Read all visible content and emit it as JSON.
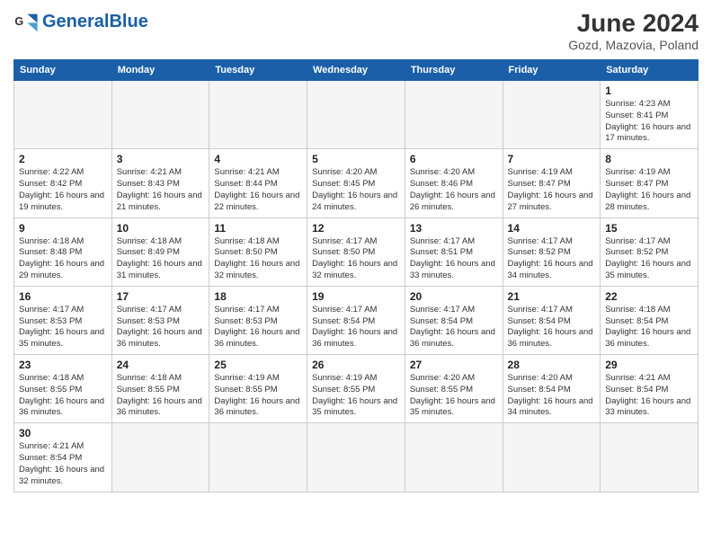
{
  "header": {
    "logo_general": "General",
    "logo_blue": "Blue",
    "month_year": "June 2024",
    "location": "Gozd, Mazovia, Poland"
  },
  "days_of_week": [
    "Sunday",
    "Monday",
    "Tuesday",
    "Wednesday",
    "Thursday",
    "Friday",
    "Saturday"
  ],
  "weeks": [
    [
      {
        "num": "",
        "info": ""
      },
      {
        "num": "",
        "info": ""
      },
      {
        "num": "",
        "info": ""
      },
      {
        "num": "",
        "info": ""
      },
      {
        "num": "",
        "info": ""
      },
      {
        "num": "",
        "info": ""
      },
      {
        "num": "1",
        "info": "Sunrise: 4:23 AM\nSunset: 8:41 PM\nDaylight: 16 hours and 17 minutes."
      }
    ],
    [
      {
        "num": "2",
        "info": "Sunrise: 4:22 AM\nSunset: 8:42 PM\nDaylight: 16 hours and 19 minutes."
      },
      {
        "num": "3",
        "info": "Sunrise: 4:21 AM\nSunset: 8:43 PM\nDaylight: 16 hours and 21 minutes."
      },
      {
        "num": "4",
        "info": "Sunrise: 4:21 AM\nSunset: 8:44 PM\nDaylight: 16 hours and 22 minutes."
      },
      {
        "num": "5",
        "info": "Sunrise: 4:20 AM\nSunset: 8:45 PM\nDaylight: 16 hours and 24 minutes."
      },
      {
        "num": "6",
        "info": "Sunrise: 4:20 AM\nSunset: 8:46 PM\nDaylight: 16 hours and 26 minutes."
      },
      {
        "num": "7",
        "info": "Sunrise: 4:19 AM\nSunset: 8:47 PM\nDaylight: 16 hours and 27 minutes."
      },
      {
        "num": "8",
        "info": "Sunrise: 4:19 AM\nSunset: 8:47 PM\nDaylight: 16 hours and 28 minutes."
      }
    ],
    [
      {
        "num": "9",
        "info": "Sunrise: 4:18 AM\nSunset: 8:48 PM\nDaylight: 16 hours and 29 minutes."
      },
      {
        "num": "10",
        "info": "Sunrise: 4:18 AM\nSunset: 8:49 PM\nDaylight: 16 hours and 31 minutes."
      },
      {
        "num": "11",
        "info": "Sunrise: 4:18 AM\nSunset: 8:50 PM\nDaylight: 16 hours and 32 minutes."
      },
      {
        "num": "12",
        "info": "Sunrise: 4:17 AM\nSunset: 8:50 PM\nDaylight: 16 hours and 32 minutes."
      },
      {
        "num": "13",
        "info": "Sunrise: 4:17 AM\nSunset: 8:51 PM\nDaylight: 16 hours and 33 minutes."
      },
      {
        "num": "14",
        "info": "Sunrise: 4:17 AM\nSunset: 8:52 PM\nDaylight: 16 hours and 34 minutes."
      },
      {
        "num": "15",
        "info": "Sunrise: 4:17 AM\nSunset: 8:52 PM\nDaylight: 16 hours and 35 minutes."
      }
    ],
    [
      {
        "num": "16",
        "info": "Sunrise: 4:17 AM\nSunset: 8:53 PM\nDaylight: 16 hours and 35 minutes."
      },
      {
        "num": "17",
        "info": "Sunrise: 4:17 AM\nSunset: 8:53 PM\nDaylight: 16 hours and 36 minutes."
      },
      {
        "num": "18",
        "info": "Sunrise: 4:17 AM\nSunset: 8:53 PM\nDaylight: 16 hours and 36 minutes."
      },
      {
        "num": "19",
        "info": "Sunrise: 4:17 AM\nSunset: 8:54 PM\nDaylight: 16 hours and 36 minutes."
      },
      {
        "num": "20",
        "info": "Sunrise: 4:17 AM\nSunset: 8:54 PM\nDaylight: 16 hours and 36 minutes."
      },
      {
        "num": "21",
        "info": "Sunrise: 4:17 AM\nSunset: 8:54 PM\nDaylight: 16 hours and 36 minutes."
      },
      {
        "num": "22",
        "info": "Sunrise: 4:18 AM\nSunset: 8:54 PM\nDaylight: 16 hours and 36 minutes."
      }
    ],
    [
      {
        "num": "23",
        "info": "Sunrise: 4:18 AM\nSunset: 8:55 PM\nDaylight: 16 hours and 36 minutes."
      },
      {
        "num": "24",
        "info": "Sunrise: 4:18 AM\nSunset: 8:55 PM\nDaylight: 16 hours and 36 minutes."
      },
      {
        "num": "25",
        "info": "Sunrise: 4:19 AM\nSunset: 8:55 PM\nDaylight: 16 hours and 36 minutes."
      },
      {
        "num": "26",
        "info": "Sunrise: 4:19 AM\nSunset: 8:55 PM\nDaylight: 16 hours and 35 minutes."
      },
      {
        "num": "27",
        "info": "Sunrise: 4:20 AM\nSunset: 8:55 PM\nDaylight: 16 hours and 35 minutes."
      },
      {
        "num": "28",
        "info": "Sunrise: 4:20 AM\nSunset: 8:54 PM\nDaylight: 16 hours and 34 minutes."
      },
      {
        "num": "29",
        "info": "Sunrise: 4:21 AM\nSunset: 8:54 PM\nDaylight: 16 hours and 33 minutes."
      }
    ],
    [
      {
        "num": "30",
        "info": "Sunrise: 4:21 AM\nSunset: 8:54 PM\nDaylight: 16 hours and 32 minutes."
      },
      {
        "num": "",
        "info": ""
      },
      {
        "num": "",
        "info": ""
      },
      {
        "num": "",
        "info": ""
      },
      {
        "num": "",
        "info": ""
      },
      {
        "num": "",
        "info": ""
      },
      {
        "num": "",
        "info": ""
      }
    ]
  ]
}
